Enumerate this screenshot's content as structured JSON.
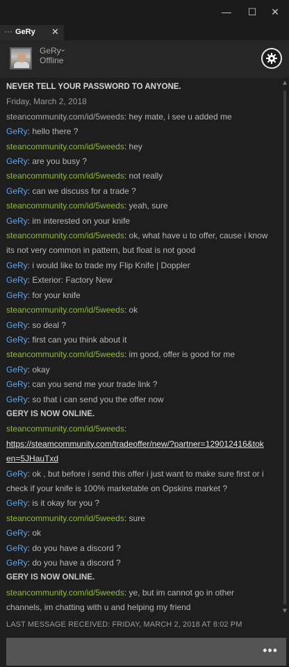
{
  "window": {
    "controls": [
      "minimize-icon",
      "maximize-icon",
      "close-icon"
    ]
  },
  "tab": {
    "dots": "···",
    "label": "GeRy",
    "close": "✕"
  },
  "header": {
    "name": "GeRy",
    "status": "Offline",
    "chevron": "⌄"
  },
  "chat": {
    "notice": "NEVER TELL YOUR PASSWORD TO ANYONE.",
    "date": "Friday, March 2, 2018",
    "messages": [
      {
        "type": "msg",
        "who": "them",
        "name": "steancommunity.com/id/5weeds",
        "text": "hey mate, i see u added me",
        "grey": true
      },
      {
        "type": "msg",
        "who": "me",
        "name": "GeRy",
        "text": "hello there ?"
      },
      {
        "type": "msg",
        "who": "them",
        "name": "steancommunity.com/id/5weeds",
        "text": "hey"
      },
      {
        "type": "msg",
        "who": "me",
        "name": "GeRy",
        "text": "are you busy ?"
      },
      {
        "type": "msg",
        "who": "them",
        "name": "steancommunity.com/id/5weeds",
        "text": "not really"
      },
      {
        "type": "msg",
        "who": "me",
        "name": "GeRy",
        "text": "can we discuss for a trade ?"
      },
      {
        "type": "msg",
        "who": "them",
        "name": "steancommunity.com/id/5weeds",
        "text": "yeah, sure"
      },
      {
        "type": "msg",
        "who": "me",
        "name": "GeRy",
        "text": "im interested on your knife"
      },
      {
        "type": "msg",
        "who": "them",
        "name": "steancommunity.com/id/5weeds",
        "text": "ok, what have u to offer, cause i know its not very common in pattern, but float is not good"
      },
      {
        "type": "msg",
        "who": "me",
        "name": "GeRy",
        "text": "i would like to trade my Flip Knife | Doppler"
      },
      {
        "type": "msg",
        "who": "me",
        "name": "GeRy",
        "text": "Exterior: Factory New"
      },
      {
        "type": "msg",
        "who": "me",
        "name": "GeRy",
        "text": "for your knife"
      },
      {
        "type": "msg",
        "who": "them",
        "name": "steancommunity.com/id/5weeds",
        "text": "ok"
      },
      {
        "type": "msg",
        "who": "me",
        "name": "GeRy",
        "text": "so deal ?"
      },
      {
        "type": "msg",
        "who": "me",
        "name": "GeRy",
        "text": "first can you think about it"
      },
      {
        "type": "msg",
        "who": "them",
        "name": "steancommunity.com/id/5weeds",
        "text": "im good, offer is good for me"
      },
      {
        "type": "msg",
        "who": "me",
        "name": "GeRy",
        "text": "okay"
      },
      {
        "type": "msg",
        "who": "me",
        "name": "GeRy",
        "text": "can you send me your trade link ?"
      },
      {
        "type": "msg",
        "who": "me",
        "name": "GeRy",
        "text": "so that i can send you the offer now"
      },
      {
        "type": "sys",
        "text": "GERY IS NOW ONLINE."
      },
      {
        "type": "msg",
        "who": "them",
        "name": "steancommunity.com/id/5weeds",
        "text": ""
      },
      {
        "type": "link",
        "text": "https://steamcommunity.com/tradeoffer/new/?partner=129012416&token=5JHauTxd"
      },
      {
        "type": "msg",
        "who": "me",
        "name": "GeRy",
        "text": "ok , but before i send this offer i just want to make sure first or i check if your knife is 100% marketable on Opskins market ?"
      },
      {
        "type": "msg",
        "who": "me",
        "name": "GeRy",
        "text": "is it okay for you ?"
      },
      {
        "type": "msg",
        "who": "them",
        "name": "steancommunity.com/id/5weeds",
        "text": "sure"
      },
      {
        "type": "msg",
        "who": "me",
        "name": "GeRy",
        "text": "ok"
      },
      {
        "type": "msg",
        "who": "me",
        "name": "GeRy",
        "text": "do you have a discord ?"
      },
      {
        "type": "msg",
        "who": "me",
        "name": "GeRy",
        "text": "do you have a discord ?"
      },
      {
        "type": "sys",
        "text": "GERY IS NOW ONLINE."
      },
      {
        "type": "msg",
        "who": "them",
        "name": "steancommunity.com/id/5weeds",
        "text": "ye, but im cannot go in other channels, im chatting with u and helping my friend"
      }
    ]
  },
  "footer": {
    "last_received": "LAST MESSAGE RECEIVED: FRIDAY, MARCH 2, 2018 AT 8:02 PM",
    "more": "•••"
  },
  "colors": {
    "me": "#62a6e9",
    "them": "#90ba3c",
    "background": "#1e1e1f"
  }
}
